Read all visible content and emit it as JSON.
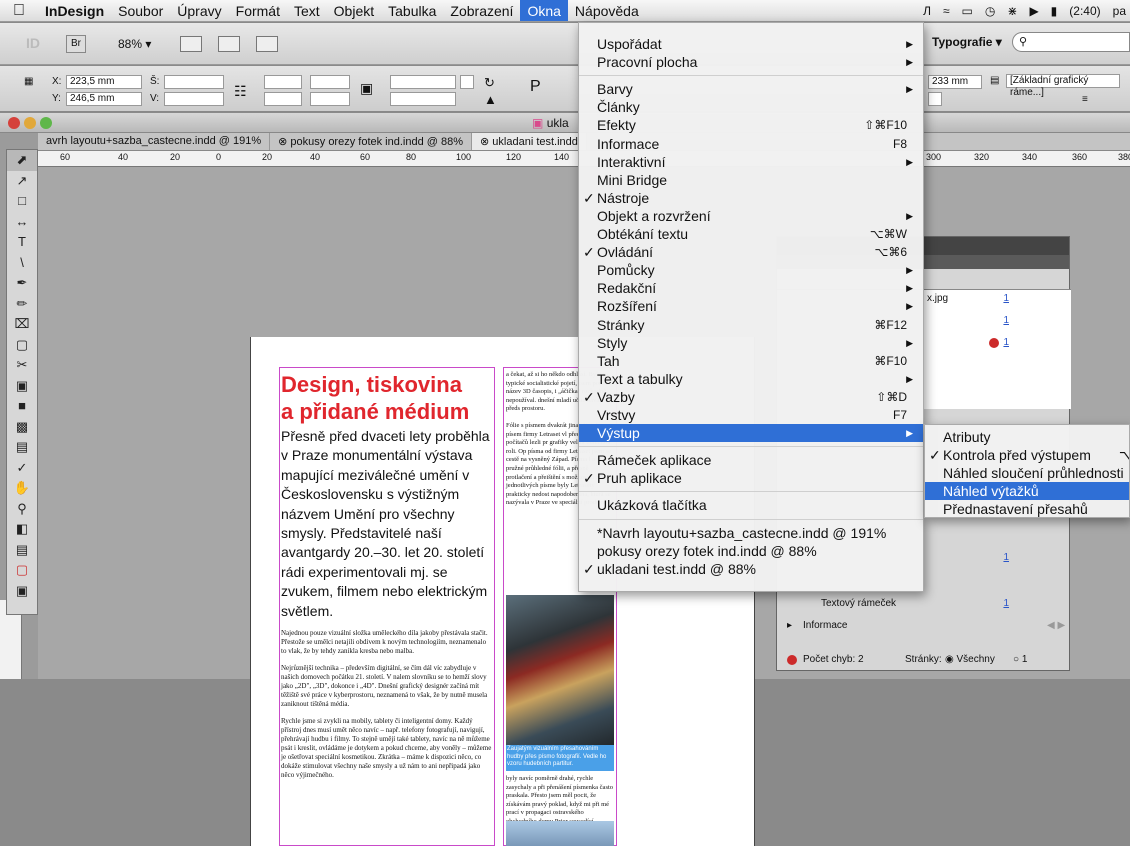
{
  "menubar": {
    "app": "InDesign",
    "items": [
      "Soubor",
      "Úpravy",
      "Formát",
      "Text",
      "Objekt",
      "Tabulka",
      "Zobrazení",
      "Okna",
      "Nápověda"
    ],
    "active": "Okna",
    "battery": "(2:40)",
    "user_partial": "pa"
  },
  "appbar": {
    "logo": "ID",
    "bridge": "Br",
    "zoom": "88%",
    "workspace": "Typografie ▾"
  },
  "control": {
    "x_label": "X:",
    "x_value": "223,5 mm",
    "y_label": "Y:",
    "y_value": "246,5 mm",
    "w_label": "Š:",
    "h_label": "V:",
    "pos_value": "233 mm",
    "frame_style": "[Základní grafický ráme...]"
  },
  "window": {
    "title": "ukla",
    "tabs": [
      "avrh layoutu+sazba_castecne.indd @ 191%",
      "pokusy orezy fotek ind.indd @ 88%",
      "ukladani test.indd"
    ],
    "ruler": [
      "60",
      "40",
      "20",
      "0",
      "20",
      "40",
      "60",
      "80",
      "100",
      "120",
      "140",
      "300",
      "320",
      "340",
      "360",
      "380"
    ]
  },
  "document": {
    "headline_1": "Design, tiskovina",
    "headline_2": "a přidané médium",
    "lead": "Přesně před dvaceti lety proběhla v Praze monumentální výstava mapující meziválečné umění v Československu s výstižným názvem Umění pro všechny smysly. Představitelé naší avantgardy 20.–30. let 20. století rádi experimentovali mj. se zvukem, filmem nebo elektrickým světlem.",
    "body_1": "Najednou pouze vizuální složka uměleckého díla jakoby přestávala stačit. Přestože se umělci netajili obdivem k novým technologiím, neznamenalo to vlak, že by tehdy zanikla kresba nebo malba.",
    "body_2": "Nejrůznější technika – především digitální, se čím dál víc zabydluje v našich domovech počátku 21. století. V nalem slovníku se to hemží slovy jako „2D\", „3D\", dokonce i „4D\". Dnešní grafický designér začíná mít těžiště své práce v kyberprostoru, neznamená to však, že by nutně musela zaniknout tištěná média.",
    "body_3": "Rychle jsme si zvykli na mobily, tablety či inteligentní domy. Každý přístroj dnes musí umět něco navíc – např. telefony fotografují, navigují, přehrávají hudbu i filmy. To stejně umějí také tablety, navíc na ně můžeme psát i kreslit, ovládáme je dotykem a pokud chceme, aby voněly – můžeme je ošetřovat speciální kosmetikou. Zkrátka – máme k dispozici něco, co dokáže stimulovat všechny naše smysly a už nám to ani nepřipadá jako něco výjimečného.",
    "col2_1": "a čekat, až si ho někdo odhlásí. Bylo to typické socialistické pojetí, jsem použil název 3D časopis, i „áčička\" rozhodně nepoužíval. dnešní mladí učitě dávají předs prostoru.",
    "col2_2": "Fólie s písmem dvakrát jinak Katalog písem firmy Letraset vl před příchodem počítačů lezli pr grafiky velmi důležitou roli. Op písma od firmy Letraset jsem se cestě na vysněný Západ. Písma l a přitom pružné průhledné fólii, a přesně protlačení a přeištění s možnost si z jednotlivých písme byly Letrasety prakticky nedost napodobenina, která se nazývala v Praze ve speciální prodejně v",
    "caption": "Zaujatým vizuálním přesahováním hudby přes písmo fotografií. Vedle ho vzoru hudebních partitur.",
    "col2_3": "byly navíc poměrně drahé, rychle zasychaly a při přenášení písmenka často praskala. Přesto jsem měl pocit, že získávám pravý poklad, když mi při mé prací v propagaci ostravského obchodního domu Prior sousedící dovolili vzít si"
  },
  "okna_menu": {
    "items": [
      {
        "label": "Uspořádat",
        "sub": true
      },
      {
        "label": "Pracovní plocha",
        "sub": true
      },
      {
        "sep": true
      },
      {
        "label": "Barvy",
        "sub": true
      },
      {
        "label": "Články"
      },
      {
        "label": "Efekty",
        "shortcut": "⇧⌘F10"
      },
      {
        "label": "Informace",
        "shortcut": "F8"
      },
      {
        "label": "Interaktivní",
        "sub": true
      },
      {
        "label": "Mini Bridge"
      },
      {
        "label": "Nástroje",
        "check": true
      },
      {
        "label": "Objekt a rozvržení",
        "sub": true
      },
      {
        "label": "Obtékání textu",
        "shortcut": "⌥⌘W"
      },
      {
        "label": "Ovládání",
        "check": true,
        "shortcut": "⌥⌘6"
      },
      {
        "label": "Pomůcky",
        "sub": true
      },
      {
        "label": "Redakční",
        "sub": true
      },
      {
        "label": "Rozšíření",
        "sub": true
      },
      {
        "label": "Stránky",
        "shortcut": "⌘F12"
      },
      {
        "label": "Styly",
        "sub": true
      },
      {
        "label": "Tah",
        "shortcut": "⌘F10"
      },
      {
        "label": "Text a tabulky",
        "sub": true
      },
      {
        "label": "Vazby",
        "check": true,
        "shortcut": "⇧⌘D"
      },
      {
        "label": "Vrstvy",
        "shortcut": "F7"
      },
      {
        "label": "Výstup",
        "sub": true,
        "highlight": true
      },
      {
        "sep": true
      },
      {
        "label": "Rámeček aplikace"
      },
      {
        "label": "Pruh aplikace",
        "check": true
      },
      {
        "sep": true
      },
      {
        "label": "Ukázková tlačítka"
      },
      {
        "sep": true
      },
      {
        "label": "*Navrh layoutu+sazba_castecne.indd @ 191%"
      },
      {
        "label": "pokusy orezy fotek ind.indd @ 88%"
      },
      {
        "label": "ukladani test.indd @ 88%",
        "check": true
      }
    ]
  },
  "vystup_submenu": {
    "items": [
      {
        "label": "Atributy"
      },
      {
        "label": "Kontrola před výstupem",
        "check": true,
        "shortcut": "⌥"
      },
      {
        "label": "Náhled sloučení průhlednosti"
      },
      {
        "label": "Náhled výtažků",
        "highlight": true
      },
      {
        "label": "Přednastavení přesahů"
      }
    ]
  },
  "panel": {
    "rows": [
      {
        "name": "x.jpg",
        "count": "1"
      },
      {
        "name": "",
        "count": "1"
      },
      {
        "name": "",
        "count": "1",
        "error": true
      }
    ],
    "lower_count": "1",
    "text_frame": "Textový rámeček",
    "text_frame_count": "1",
    "info": "Informace",
    "error_count": "Počet chyb: 2",
    "pages_label": "Stránky:",
    "pages_all": "Všechny",
    "pages_input": "1"
  },
  "colors": {
    "accent": "#2f6fd6",
    "headline": "#e0262d",
    "guide": "#c94ac9"
  }
}
